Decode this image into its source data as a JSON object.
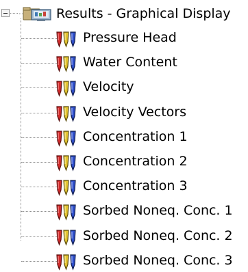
{
  "tree": {
    "root": {
      "label": "Results - Graphical Display",
      "icon": "folder-display-icon",
      "expanded": true
    },
    "items": [
      {
        "label": "Pressure Head",
        "icon": "chart-icon"
      },
      {
        "label": "Water Content",
        "icon": "chart-icon"
      },
      {
        "label": "Velocity",
        "icon": "chart-icon"
      },
      {
        "label": "Velocity Vectors",
        "icon": "chart-icon"
      },
      {
        "label": "Concentration 1",
        "icon": "chart-icon"
      },
      {
        "label": "Concentration 2",
        "icon": "chart-icon"
      },
      {
        "label": "Concentration 3",
        "icon": "chart-icon"
      },
      {
        "label": "Sorbed Noneq. Conc. 1",
        "icon": "chart-icon"
      },
      {
        "label": "Sorbed Noneq. Conc. 2",
        "icon": "chart-icon"
      },
      {
        "label": "Sorbed Noneq. Conc. 3",
        "icon": "chart-icon"
      }
    ]
  }
}
